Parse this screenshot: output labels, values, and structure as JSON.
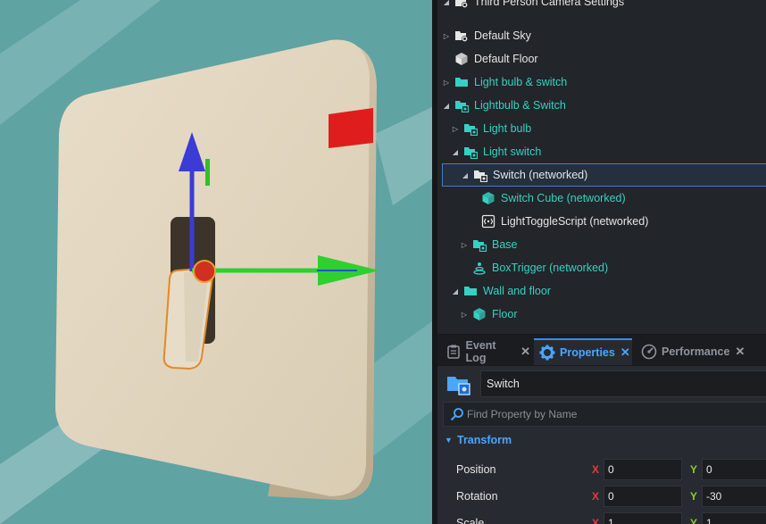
{
  "hierarchy": {
    "items": [
      {
        "label": "Third Person Camera Settings",
        "icon": "settings-object-icon",
        "color": "white",
        "arrow": "expanded",
        "indent": 0
      },
      {
        "label": "Default Sky",
        "icon": "settings-object-icon",
        "color": "white",
        "arrow": "collapsed",
        "indent": 0
      },
      {
        "label": "Default Floor",
        "icon": "cube-icon",
        "color": "white",
        "arrow": "none",
        "indent": 0
      },
      {
        "label": "Light bulb & switch",
        "icon": "folder-icon",
        "color": "teal",
        "arrow": "collapsed",
        "indent": 0
      },
      {
        "label": "Lightbulb & Switch",
        "icon": "networked-folder-icon",
        "color": "teal",
        "arrow": "expanded",
        "indent": 0
      },
      {
        "label": "Light bulb",
        "icon": "networked-folder-icon",
        "color": "teal",
        "arrow": "collapsed",
        "indent": 1
      },
      {
        "label": "Light switch",
        "icon": "networked-folder-icon",
        "color": "teal",
        "arrow": "expanded",
        "indent": 1
      },
      {
        "label": "Switch (networked)",
        "icon": "networked-folder-icon",
        "color": "white",
        "arrow": "expanded",
        "indent": 2,
        "selected": true
      },
      {
        "label": "Switch Cube (networked)",
        "icon": "cube-icon",
        "color": "teal",
        "arrow": "none",
        "indent": 3
      },
      {
        "label": "LightToggleScript (networked)",
        "icon": "script-icon",
        "color": "white",
        "arrow": "none",
        "indent": 3
      },
      {
        "label": "Base",
        "icon": "networked-folder-icon",
        "color": "teal",
        "arrow": "collapsed",
        "indent": 2
      },
      {
        "label": "BoxTrigger (networked)",
        "icon": "trigger-icon",
        "color": "teal",
        "arrow": "none",
        "indent": 2
      },
      {
        "label": "Wall and floor",
        "icon": "folder-icon",
        "color": "teal",
        "arrow": "expanded",
        "indent": 1
      },
      {
        "label": "Floor",
        "icon": "cube-icon",
        "color": "teal",
        "arrow": "collapsed",
        "indent": 2
      }
    ]
  },
  "tabs": [
    {
      "label": "Event Log",
      "icon": "clipboard-icon",
      "active": false
    },
    {
      "label": "Properties",
      "icon": "gear-icon",
      "active": true
    },
    {
      "label": "Performance",
      "icon": "gauge-icon",
      "active": false
    }
  ],
  "properties": {
    "object_name": "Switch",
    "search_placeholder": "Find Property by Name",
    "section_title": "Transform",
    "x_label": "X",
    "y_label": "Y",
    "rows": [
      {
        "label": "Position",
        "x": "0",
        "y": "0"
      },
      {
        "label": "Rotation",
        "x": "0",
        "y": "-30"
      },
      {
        "label": "Scale",
        "x": "1",
        "y": "1"
      }
    ]
  },
  "colors": {
    "teal_text": "#36d1c4",
    "accent_blue": "#4aa6ff",
    "axis_x": "#e23b3b",
    "axis_y": "#8ccd2f"
  }
}
